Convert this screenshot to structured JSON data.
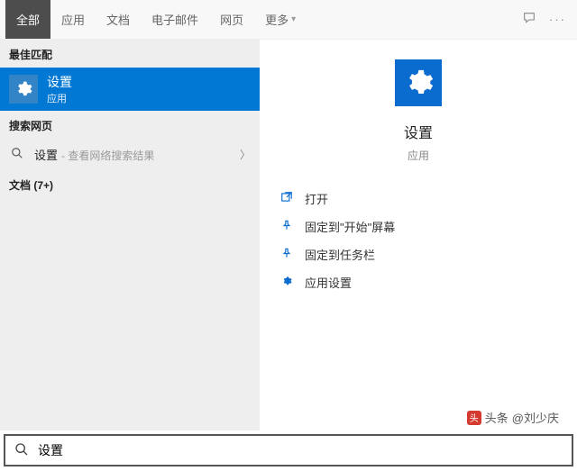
{
  "tabs": {
    "all": "全部",
    "apps": "应用",
    "documents": "文档",
    "emails": "电子邮件",
    "web": "网页",
    "more": "更多"
  },
  "left": {
    "best_match_header": "最佳匹配",
    "best_match": {
      "title": "设置",
      "subtitle": "应用"
    },
    "search_web_header": "搜索网页",
    "web_result": {
      "query": "设置",
      "hint": "- 查看网络搜索结果"
    },
    "docs_header": "文档 (7+)"
  },
  "right": {
    "title": "设置",
    "subtitle": "应用",
    "actions": {
      "open": "打开",
      "pin_start": "固定到\"开始\"屏幕",
      "pin_taskbar": "固定到任务栏",
      "app_settings": "应用设置"
    }
  },
  "search": {
    "value": "设置"
  },
  "watermark": {
    "prefix": "头条",
    "author": "@刘少庆"
  }
}
